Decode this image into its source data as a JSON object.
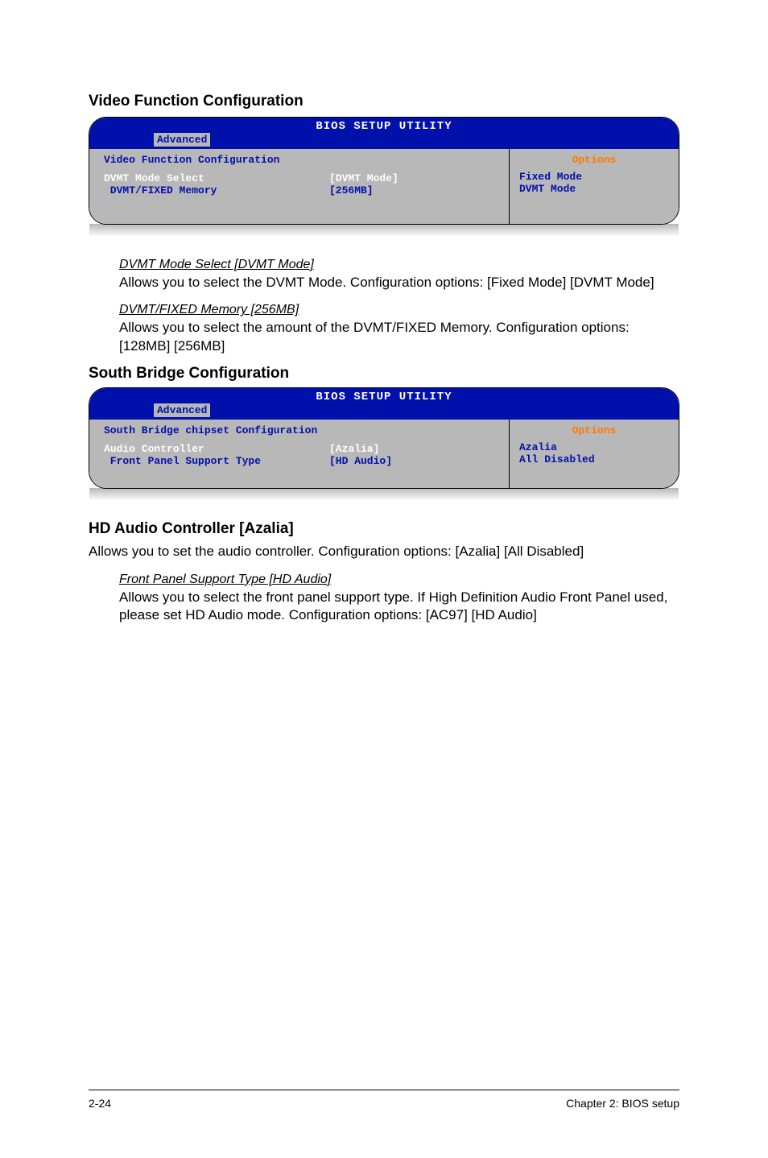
{
  "headings": {
    "video_func": "Video Function Configuration",
    "south_bridge": "South Bridge Configuration",
    "hd_audio": "HD Audio Controller [Azalia]"
  },
  "bios1": {
    "title": "BIOS SETUP UTILITY",
    "tab": "Advanced",
    "section": "Video Function Configuration",
    "rows": [
      {
        "label": "DVMT Mode Select",
        "value": "[DVMT Mode]",
        "style": "white"
      },
      {
        "label": " DVMT/FIXED Memory",
        "value": "[256MB]",
        "style": "dark"
      }
    ],
    "options_title": "Options",
    "options": [
      "Fixed Mode",
      "DVMT Mode"
    ]
  },
  "bios2": {
    "title": "BIOS SETUP UTILITY",
    "tab": "Advanced",
    "section": "South Bridge chipset Configuration",
    "rows": [
      {
        "label": "Audio Controller",
        "value": "[Azalia]",
        "style": "white"
      },
      {
        "label": " Front Panel Support Type",
        "value": "[HD Audio]",
        "style": "dark"
      }
    ],
    "options_title": "Options",
    "options": [
      "Azalia",
      "All Disabled"
    ]
  },
  "texts": {
    "dvmt_mode_label": "DVMT Mode Select [DVMT Mode]",
    "dvmt_mode_body": "Allows you to select the DVMT Mode. Configuration options: [Fixed Mode] [DVMT Mode]",
    "dvmt_fixed_label": "DVMT/FIXED Memory [256MB]",
    "dvmt_fixed_body": "Allows you to select the amount of the DVMT/FIXED Memory. Configuration options: [128MB] [256MB]",
    "hd_audio_body_intro": "Allows you to set the audio controller. Configuration options: [Azalia] [All Disabled]",
    "front_panel_label": " Front Panel Support Type [HD Audio]",
    "front_panel_body": "Allows you to select the front panel support type. If High Definition Audio Front Panel used, please set HD Audio mode. Configuration options: [AC97] [HD Audio]"
  },
  "footer": {
    "left": "2-24",
    "right": "Chapter 2: BIOS setup"
  }
}
